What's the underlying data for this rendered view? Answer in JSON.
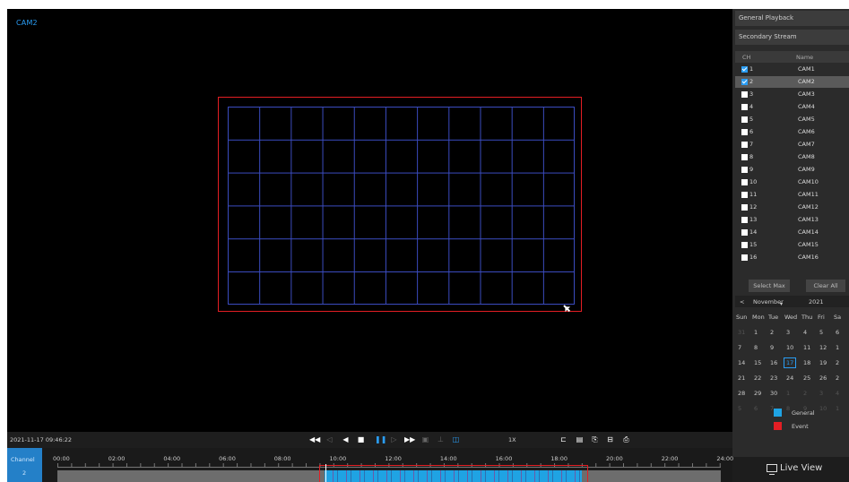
{
  "video": {
    "cam_label": "CAM2"
  },
  "panel": {
    "mode": "General Playback",
    "stream": "Secondary Stream",
    "col_ch": "CH",
    "col_name": "Name",
    "channels": [
      {
        "num": "1",
        "name": "CAM1",
        "checked": true
      },
      {
        "num": "2",
        "name": "CAM2",
        "checked": true,
        "selected": true
      },
      {
        "num": "3",
        "name": "CAM3",
        "checked": false
      },
      {
        "num": "4",
        "name": "CAM4",
        "checked": false
      },
      {
        "num": "5",
        "name": "CAM5",
        "checked": false
      },
      {
        "num": "6",
        "name": "CAM6",
        "checked": false
      },
      {
        "num": "7",
        "name": "CAM7",
        "checked": false
      },
      {
        "num": "8",
        "name": "CAM8",
        "checked": false
      },
      {
        "num": "9",
        "name": "CAM9",
        "checked": false
      },
      {
        "num": "10",
        "name": "CAM10",
        "checked": false
      },
      {
        "num": "11",
        "name": "CAM11",
        "checked": false
      },
      {
        "num": "12",
        "name": "CAM12",
        "checked": false
      },
      {
        "num": "13",
        "name": "CAM13",
        "checked": false
      },
      {
        "num": "14",
        "name": "CAM14",
        "checked": false
      },
      {
        "num": "15",
        "name": "CAM15",
        "checked": false
      },
      {
        "num": "16",
        "name": "CAM16",
        "checked": false
      }
    ],
    "select_max": "Select Max",
    "clear_all": "Clear All",
    "calendar": {
      "prev": "<",
      "month": "November",
      "year": "2021",
      "weekdays": [
        "Sun",
        "Mon",
        "Tue",
        "Wed",
        "Thu",
        "Fri",
        "Sa"
      ],
      "weeks": [
        [
          "31",
          "1",
          "2",
          "3",
          "4",
          "5",
          "6"
        ],
        [
          "7",
          "8",
          "9",
          "10",
          "11",
          "12",
          "1"
        ],
        [
          "14",
          "15",
          "16",
          "17",
          "18",
          "19",
          "2"
        ],
        [
          "21",
          "22",
          "23",
          "24",
          "25",
          "26",
          "2"
        ],
        [
          "28",
          "29",
          "30",
          "1",
          "2",
          "3",
          "4"
        ],
        [
          "5",
          "6",
          "7",
          "8",
          "9",
          "10",
          "1"
        ]
      ],
      "selected_day": "17"
    },
    "legend": [
      {
        "label": "General",
        "color": "#1fa3e3"
      },
      {
        "label": "Event",
        "color": "#e31e24"
      }
    ],
    "live_view": "Live View"
  },
  "controls": {
    "timestamp": "2021-11-17 09:46:22",
    "speed": "1X"
  },
  "timeline": {
    "channel_label": "Channel",
    "channel_num": "2",
    "ticks": [
      "00:00",
      "02:00",
      "04:00",
      "06:00",
      "08:00",
      "10:00",
      "12:00",
      "14:00",
      "16:00",
      "18:00",
      "20:00",
      "22:00",
      "24:00"
    ]
  }
}
